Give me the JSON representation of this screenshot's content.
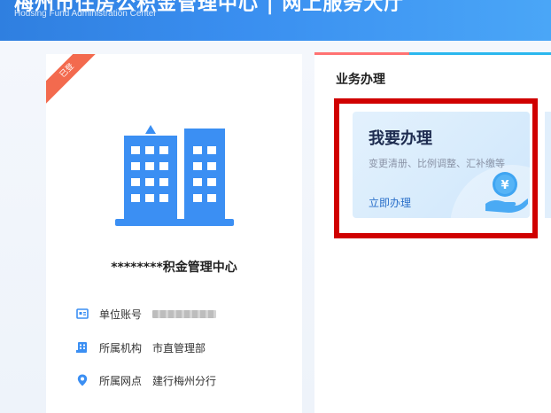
{
  "header": {
    "title": "梅州市住房公积金管理中心 | 网上服务大厅",
    "subtitle": "Housing Fund Administration Center"
  },
  "org_card": {
    "ribbon": "已登",
    "name": "********积金管理中心",
    "rows": [
      {
        "label": "单位账号",
        "value": "",
        "icon": "id-card-icon"
      },
      {
        "label": "所属机构",
        "value": "市直管理部",
        "icon": "org-icon"
      },
      {
        "label": "所属网点",
        "value": "建行梅州分行",
        "icon": "location-pin-icon"
      }
    ]
  },
  "business": {
    "section_title": "业务办理",
    "card": {
      "title": "我要办理",
      "description": "变更清册、比例调整、汇补缴等",
      "link": "立即办理",
      "coin_symbol": "¥"
    }
  },
  "colors": {
    "header_blue": "#3a8ff0",
    "icon_blue": "#3b8ff3",
    "ribbon": "#f36a4e",
    "highlight": "#d00000"
  }
}
